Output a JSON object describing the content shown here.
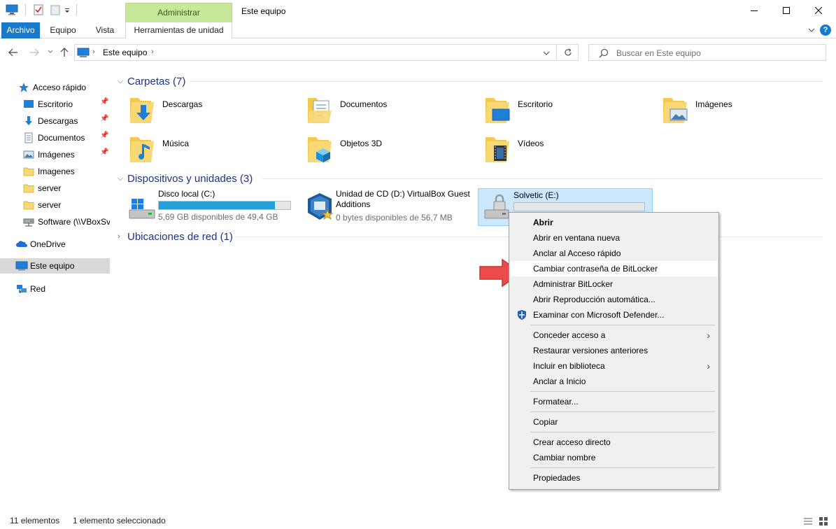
{
  "window": {
    "title": "Este equipo",
    "context_tab_group": "Administrar",
    "controls": {
      "minimize": "—",
      "maximize": "☐",
      "close": "✕"
    }
  },
  "ribbon": {
    "tabs": [
      "Archivo",
      "Equipo",
      "Vista"
    ],
    "context_tab": "Herramientas de unidad"
  },
  "address": {
    "path": "Este equipo",
    "search_placeholder": "Buscar en Este equipo"
  },
  "nav": {
    "items": [
      {
        "label": "Acceso rápido",
        "icon": "star-icon",
        "pinned": false
      },
      {
        "label": "Escritorio",
        "icon": "desktop-icon",
        "pinned": true
      },
      {
        "label": "Descargas",
        "icon": "download-icon",
        "pinned": true
      },
      {
        "label": "Documentos",
        "icon": "document-icon",
        "pinned": true
      },
      {
        "label": "Imágenes",
        "icon": "pictures-icon",
        "pinned": true
      },
      {
        "label": "Imagenes",
        "icon": "folder-icon",
        "pinned": false
      },
      {
        "label": "server",
        "icon": "folder-icon",
        "pinned": false
      },
      {
        "label": "server",
        "icon": "folder-icon",
        "pinned": false
      },
      {
        "label": "Software (\\\\VBoxSv",
        "icon": "network-drive-icon",
        "pinned": false
      },
      {
        "label": "OneDrive",
        "icon": "cloud-icon",
        "pinned": false
      },
      {
        "label": "Este equipo",
        "icon": "computer-icon",
        "pinned": false
      },
      {
        "label": "Red",
        "icon": "network-icon",
        "pinned": false
      }
    ]
  },
  "sections": {
    "folders": "Carpetas (7)",
    "devices": "Dispositivos y unidades (3)",
    "network": "Ubicaciones de red (1)"
  },
  "folders": [
    {
      "label": "Descargas",
      "icon": "download-folder-icon"
    },
    {
      "label": "Documentos",
      "icon": "documents-folder-icon"
    },
    {
      "label": "Escritorio",
      "icon": "desktop-folder-icon"
    },
    {
      "label": "Imágenes",
      "icon": "pictures-folder-icon"
    },
    {
      "label": "Música",
      "icon": "music-folder-icon"
    },
    {
      "label": "Objetos 3D",
      "icon": "3d-objects-folder-icon"
    },
    {
      "label": "Vídeos",
      "icon": "videos-folder-icon"
    }
  ],
  "drives": [
    {
      "name": "Disco local (C:)",
      "info": "5,69 GB disponibles de 49,4 GB",
      "used_fraction": 0.885,
      "icon": "windows-drive-icon"
    },
    {
      "name": "Unidad de CD (D:) VirtualBox Guest Additions",
      "info": "0 bytes disponibles de 56,7 MB",
      "icon": "virtualbox-cd-icon"
    },
    {
      "name": "Solvetic (E:)",
      "info": "",
      "used_fraction": 0.0,
      "icon": "locked-drive-icon"
    }
  ],
  "context_menu": {
    "items": [
      {
        "label": "Abrir",
        "bold": true
      },
      {
        "label": "Abrir en ventana nueva"
      },
      {
        "label": "Anclar al Acceso rápido"
      },
      {
        "label": "Cambiar contraseña de BitLocker",
        "highlighted": true
      },
      {
        "label": "Administrar BitLocker"
      },
      {
        "label": "Abrir Reproducción automática..."
      },
      {
        "label": "Examinar con Microsoft Defender...",
        "icon": "defender-shield-icon"
      },
      {
        "label": "Conceder acceso a",
        "submenu": true
      },
      {
        "label": "Restaurar versiones anteriores"
      },
      {
        "label": "Incluir en biblioteca",
        "submenu": true
      },
      {
        "label": "Anclar a Inicio"
      },
      {
        "label": "Formatear..."
      },
      {
        "label": "Copiar"
      },
      {
        "label": "Crear acceso directo"
      },
      {
        "label": "Cambiar nombre"
      },
      {
        "label": "Propiedades"
      }
    ],
    "submenu_glyph": "›"
  },
  "status": {
    "count": "11 elementos",
    "selected": "1 elemento seleccionado"
  },
  "colors": {
    "accent": "#1979ca",
    "context_tab": "#c6e89a",
    "section_header": "#1e3287",
    "selection": "#cce8ff",
    "drive_bar": "#26a0da",
    "arrow": "#e84c4c"
  }
}
